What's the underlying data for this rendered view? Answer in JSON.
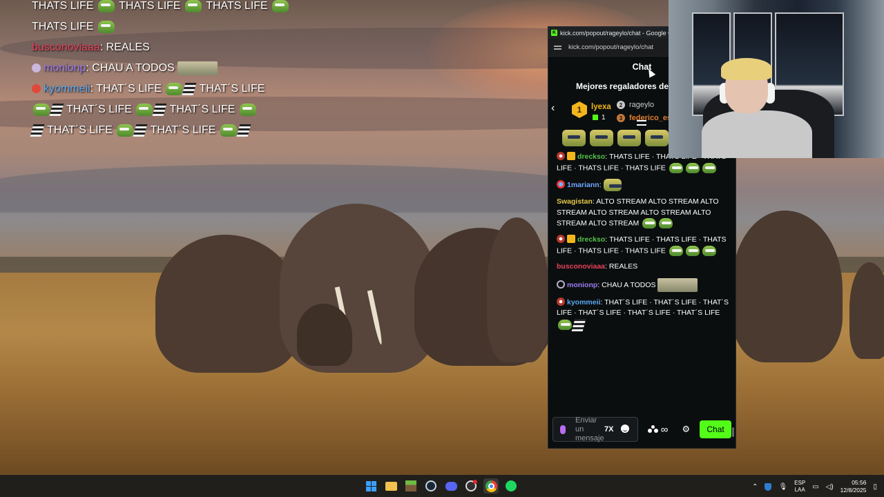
{
  "overlay_chat": {
    "lines": [
      {
        "user": "",
        "text": "THATS LIFE",
        "suffix": "THATS LIFE",
        "suffix2": "THATS LIFE",
        "user_color": "#ffffff"
      },
      {
        "user": "",
        "text": "THATS LIFE",
        "user_color": "#ffffff"
      },
      {
        "user": "busconoviaaa",
        "text": ": REALES",
        "user_color": "#e8425b"
      },
      {
        "user": "monionp",
        "text": ": CHAU A TODOS",
        "user_color": "#9b7cf0"
      },
      {
        "user": "kyommeii",
        "text": ": THAT´S LIFE",
        "user_color": "#5aa8f0"
      }
    ],
    "wrap_lines": [
      "THAT´S LIFE",
      "THAT´S LIFE",
      "THAT´S LIFE",
      "THAT´S LIFE",
      "THAT´S LIFE",
      "THAT´S LIFE"
    ]
  },
  "popout": {
    "window_title": "kick.com/popout/rageylo/chat - Google Chrome",
    "url": "kick.com/popout/rageylo/chat",
    "header": "Chat",
    "gifters_title": "Mejores regaladores de",
    "gifters": [
      {
        "rank": "1",
        "name": "lyexa",
        "count": "1"
      },
      {
        "rank": "2",
        "name": "rageylo"
      },
      {
        "rank": "3",
        "name": "federico_es"
      }
    ],
    "messages": [
      {
        "user": "drecksо",
        "user_color": "#53c24a",
        "text": ": THATS LIFE · THATS LIFE · THATS LIFE · THATS LIFE · THATS LIFE"
      },
      {
        "user": "1mariann",
        "user_color": "#6ea8ff",
        "text": ":"
      },
      {
        "user": "Swagistan",
        "user_color": "#e3c74a",
        "text": ": ALTO STREAM ALTO STREAM ALTO STREAM ALTO STREAM ALTO STREAM ALTO STREAM ALTO STREAM"
      },
      {
        "user": "drecksо",
        "user_color": "#53c24a",
        "text": ": THATS LIFE · THATS LIFE · THATS LIFE · THATS LIFE · THATS LIFE"
      },
      {
        "user": "busconoviaaa",
        "user_color": "#e8425b",
        "text": ": REALES"
      },
      {
        "user": "monionp",
        "user_color": "#9b7cf0",
        "text": ": CHAU A TODOS"
      },
      {
        "user": "kyommeii",
        "user_color": "#5aa8f0",
        "text": ": THAT´S LIFE · THAT´S LIFE · THAT´S LIFE · THAT´S LIFE · THAT´S LIFE · THAT´S LIFE"
      }
    ],
    "input_placeholder": "Enviar un mensaje",
    "chat_button": "Chat",
    "accent_color": "#53fc18"
  },
  "taskbar": {
    "language": "ESP",
    "layout": "LAA",
    "time": "05:56",
    "date": "12/8/2025",
    "pinned_icons": [
      "windows-start-icon",
      "file-explorer-icon",
      "minecraft-icon",
      "steam-icon",
      "discord-icon",
      "obs-icon",
      "chrome-icon",
      "spotify-icon"
    ]
  }
}
